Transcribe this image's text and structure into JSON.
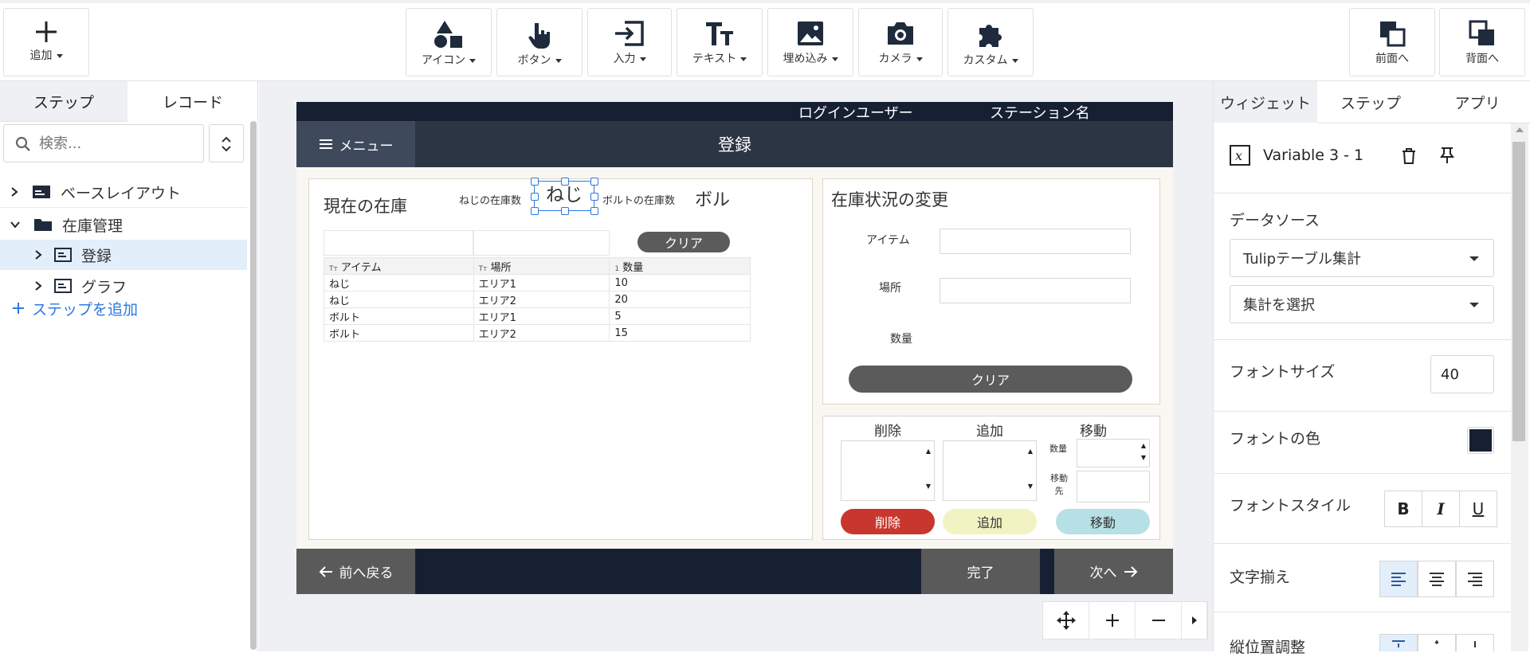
{
  "toolbar": {
    "add_label": "追加",
    "center_buttons": [
      {
        "label": "アイコン",
        "icon": "shapes-icon"
      },
      {
        "label": "ボタン",
        "icon": "pointer-hand-icon"
      },
      {
        "label": "入力",
        "icon": "input-icon"
      },
      {
        "label": "テキスト",
        "icon": "text-icon"
      },
      {
        "label": "埋め込み",
        "icon": "image-icon"
      },
      {
        "label": "カメラ",
        "icon": "camera-icon"
      },
      {
        "label": "カスタム",
        "icon": "puzzle-icon"
      }
    ],
    "front_label": "前面へ",
    "back_label": "背面へ"
  },
  "left": {
    "tabs": [
      "ステップ",
      "レコード"
    ],
    "search_placeholder": "検索...",
    "tree": [
      {
        "label": "ベースレイアウト",
        "icon": "layout-icon"
      },
      {
        "label": "在庫管理",
        "icon": "folder-icon"
      },
      {
        "label": "登録",
        "icon": "step-icon"
      },
      {
        "label": "グラフ",
        "icon": "step-icon"
      }
    ],
    "add_step": "ステップを追加"
  },
  "app": {
    "login_user": "ログインユーザー",
    "station_name": "ステーション名",
    "menu_label": "メニュー",
    "title": "登録",
    "inventory": {
      "heading": "現在の在庫",
      "screw_stock_label": "ねじの在庫数",
      "screw_value": "ねじ",
      "bolt_stock_label": "ボルトの在庫数",
      "bolt_value": "ボル",
      "clear_label": "クリア",
      "columns": [
        "アイテム",
        "場所",
        "数量"
      ],
      "column_types": [
        "Tт",
        "Tт",
        "1"
      ],
      "rows": [
        [
          "ねじ",
          "エリア1",
          "10"
        ],
        [
          "ねじ",
          "エリア2",
          "20"
        ],
        [
          "ボルト",
          "エリア1",
          "5"
        ],
        [
          "ボルト",
          "エリア2",
          "15"
        ]
      ]
    },
    "change": {
      "heading": "在庫状況の変更",
      "item_label": "アイテム",
      "location_label": "場所",
      "quantity_label": "数量",
      "clear_label": "クリア"
    },
    "actions": {
      "delete_header": "削除",
      "add_header": "追加",
      "move_header": "移動",
      "qty_label": "数量",
      "dest_label_1": "移動",
      "dest_label_2": "先",
      "delete_btn": "削除",
      "add_btn": "追加",
      "move_btn": "移動"
    },
    "nav": {
      "back": "前へ戻る",
      "done": "完了",
      "next": "次へ"
    }
  },
  "right": {
    "tabs": [
      "ウィジェット",
      "ステップ",
      "アプリ"
    ],
    "widget_name": "Variable 3 - 1",
    "datasource_label": "データソース",
    "datasource_value": "Tulipテーブル集計",
    "aggregate_value": "集計を選択",
    "font_size_label": "フォントサイズ",
    "font_size_value": "40",
    "font_color_label": "フォントの色",
    "font_color": "#172033",
    "font_style_label": "フォントスタイル",
    "align_label": "文字揃え",
    "valign_label": "縦位置調整"
  },
  "colors": {
    "accent": "#2a7ae2",
    "dark_navy": "#172033",
    "delete_red": "#c8372d",
    "add_yellow": "#f2f3c2",
    "move_teal": "#b7dfe6"
  }
}
